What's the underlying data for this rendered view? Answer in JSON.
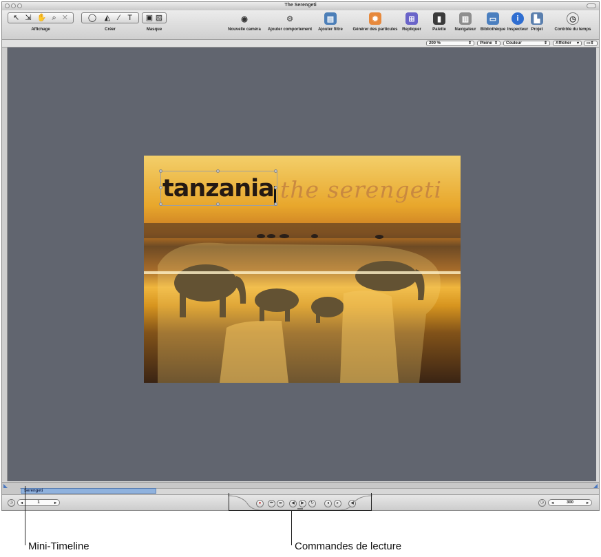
{
  "window": {
    "title": "The Serengeti"
  },
  "toolbar": {
    "groups": {
      "affichage": "Affichage",
      "creer": "Créer",
      "masque": "Masque"
    },
    "actions": {
      "nouvelle_camera": "Nouvelle caméra",
      "ajouter_comportement": "Ajouter comportement",
      "ajouter_filtre": "Ajouter filtre",
      "generer_particules": "Générer des particules",
      "repliquer": "Repliquer"
    },
    "panels": {
      "palette": "Palette",
      "navigateur": "Navigateur",
      "bibliotheque": "Bibliothèque",
      "inspecteur": "Inspecteur",
      "projet": "Projet",
      "controle_temps": "Contrôle du temps"
    }
  },
  "options_bar": {
    "zoom": "200 %",
    "resolution": "Pleine",
    "channel": "Couleur",
    "display": "Afficher"
  },
  "canvas": {
    "title_text": "tanzania",
    "subtitle_text": "the serengeti"
  },
  "mini_timeline": {
    "bar_label": "Serengeti"
  },
  "transport": {
    "current_frame": "1",
    "end_frame": "300"
  },
  "callouts": {
    "mini_timeline": "Mini-Timeline",
    "playback_controls": "Commandes de lecture"
  },
  "colors": {
    "canvas_bg": "#61656f",
    "toolbar_bg": "#d9d9d9",
    "record_button": "#c62121"
  }
}
